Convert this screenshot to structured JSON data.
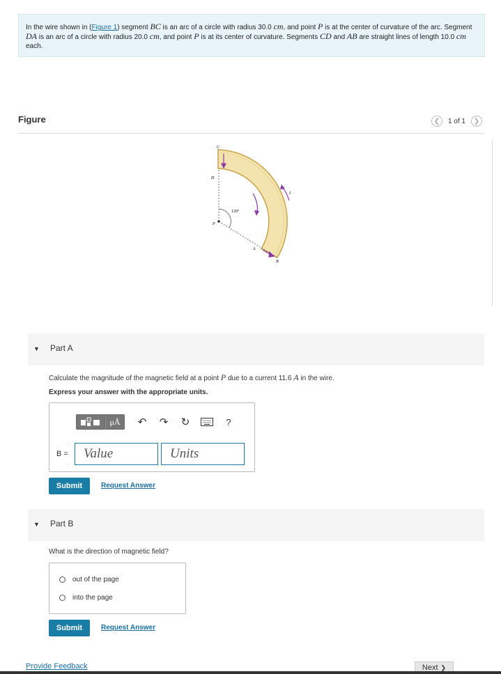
{
  "problem": {
    "text_1": "In the wire shown in (",
    "figure_link": "Figure 1",
    "text_2": ") segment ",
    "seg_bc": "BC",
    "text_3": " is an arc of a circle with radius 30.0 ",
    "unit_cm_1": "cm",
    "text_4": ", and point ",
    "point_p_1": "P",
    "text_5": " is at the center of curvature of the arc. Segment ",
    "seg_da": "DA",
    "text_6": " is an arc of a circle with radius 20.0 ",
    "unit_cm_2": "cm",
    "text_7": ", and point ",
    "point_p_2": "P",
    "text_8": " is at its center of curvature. Segments ",
    "seg_cd": "CD",
    "text_9": " and ",
    "seg_ab": "AB",
    "text_10": " are straight lines of length 10.0 ",
    "unit_cm_3": "cm",
    "text_11": " each."
  },
  "figure": {
    "title": "Figure",
    "pager_text": "1 of 1",
    "prev_icon": "chevron-left-icon",
    "next_icon": "chevron-right-icon",
    "labels": {
      "c": "C",
      "d": "D",
      "p": "P",
      "a": "A",
      "b": "B",
      "i": "I",
      "angle": "120°"
    },
    "colors": {
      "wire_fill": "#f3e3ae",
      "wire_edge": "#c9a24a",
      "arrow": "#8a3aa5"
    }
  },
  "part_a": {
    "title": "Part A",
    "question_1": "Calculate the magnitude of the magnetic field at a point ",
    "question_p": "P",
    "question_2": " due to a current 11.6 ",
    "question_unit": "A",
    "question_3": " in the wire.",
    "instruction": "Express your answer with the appropriate units.",
    "toolbar": {
      "templates_icon": "templates-icon",
      "units_label": "μÅ",
      "undo_icon": "undo-icon",
      "redo_icon": "redo-icon",
      "reset_icon": "reset-icon",
      "keyboard_icon": "keyboard-icon",
      "help_label": "?"
    },
    "b_label": "B =",
    "value_placeholder": "Value",
    "units_placeholder": "Units",
    "submit_label": "Submit",
    "request_label": "Request Answer"
  },
  "part_b": {
    "title": "Part B",
    "question": "What is the direction of magnetic field?",
    "options": [
      "out of the page",
      "into the page"
    ],
    "submit_label": "Submit",
    "request_label": "Request Answer"
  },
  "footer": {
    "feedback_label": "Provide Feedback",
    "next_label": "Next",
    "next_icon": "chevron-right-icon"
  }
}
